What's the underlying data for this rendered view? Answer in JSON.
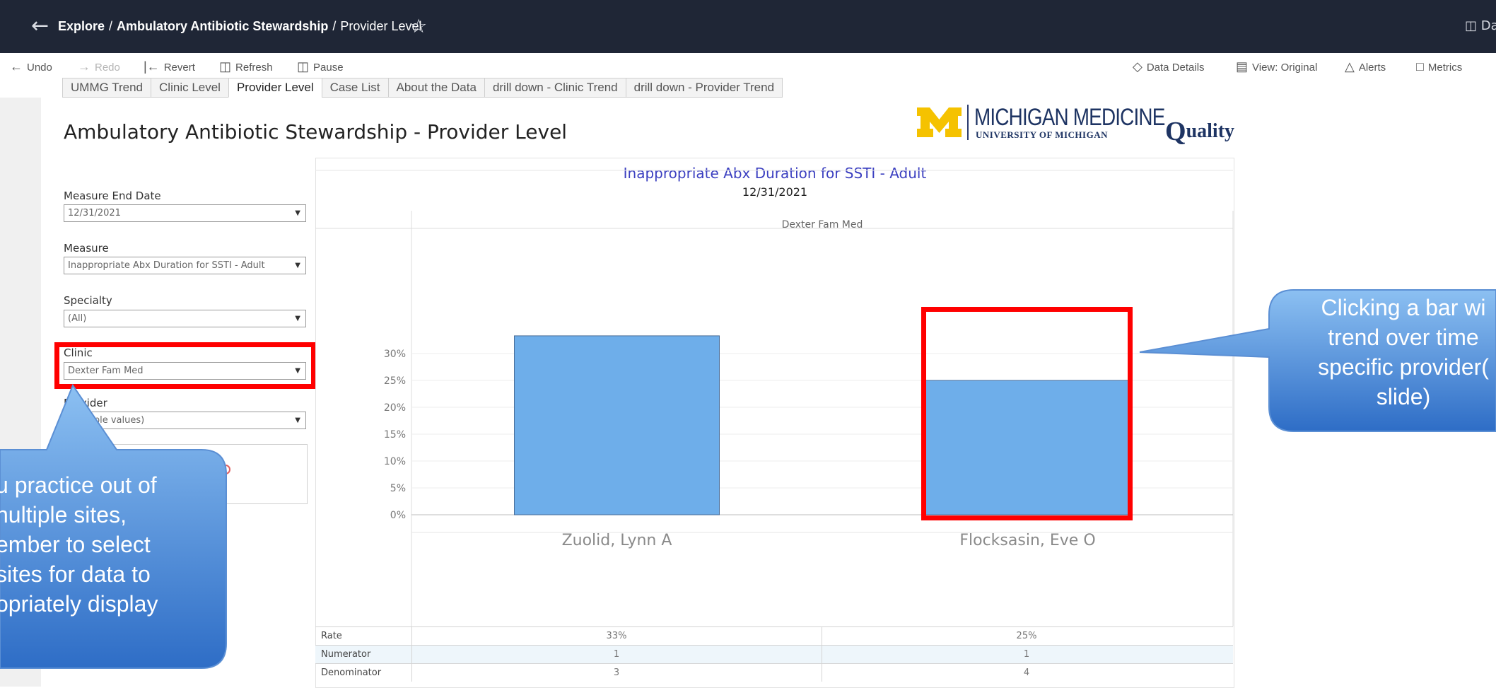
{
  "topbar": {
    "breadcrumb_explore": "Explore",
    "breadcrumb_sep1": "/",
    "breadcrumb_workbook": "Ambulatory Antibiotic Stewardship",
    "breadcrumb_sep2": "/",
    "breadcrumb_view": "Provider Level",
    "right_text": "Da"
  },
  "toolbar": {
    "undo": "Undo",
    "redo": "Redo",
    "revert": "Revert",
    "refresh": "Refresh",
    "pause": "Pause",
    "data_details": "Data Details",
    "view": "View: Original",
    "alerts": "Alerts",
    "metrics": "Metrics"
  },
  "tabs": [
    "UMMG Trend",
    "Clinic Level",
    "Provider Level",
    "Case List",
    "About the Data",
    "drill down - Clinic Trend",
    "drill down - Provider Trend"
  ],
  "active_tab": "Provider Level",
  "dashboard": {
    "title": "Ambulatory Antibiotic Stewardship - Provider Level"
  },
  "logo": {
    "main": "MICHIGAN MEDICINE",
    "sub": "UNIVERSITY OF MICHIGAN",
    "q_letter": "Q",
    "q_rest": "uality"
  },
  "filters": {
    "measure_end_date": {
      "label": "Measure End Date",
      "value": "12/31/2021"
    },
    "measure": {
      "label": "Measure",
      "value": "Inappropriate Abx Duration for SSTI - Adult"
    },
    "specialty": {
      "label": "Specialty",
      "value": "(All)"
    },
    "clinic": {
      "label": "Clinic",
      "value": "Dexter Fam Med"
    },
    "provider": {
      "label": "Provider",
      "value": "(Multiple values)"
    }
  },
  "chart_data": {
    "type": "bar",
    "title": "Inappropriate Abx Duration for SSTI - Adult",
    "subtitle": "12/31/2021",
    "panel_header": "Dexter Fam Med",
    "categories": [
      "Zuolid, Lynn A",
      "Flocksasin, Eve O"
    ],
    "values": [
      33.3,
      25
    ],
    "ylim": [
      0,
      35
    ],
    "yticks": [
      "0%",
      "5%",
      "10%",
      "15%",
      "20%",
      "25%",
      "30%"
    ],
    "bar_color": "#6eaeea",
    "grid": true
  },
  "table": {
    "rows": [
      {
        "label": "Rate",
        "values": [
          "33%",
          "25%"
        ]
      },
      {
        "label": "Numerator",
        "values": [
          "1",
          "1"
        ]
      },
      {
        "label": "Denominator",
        "values": [
          "3",
          "4"
        ]
      }
    ]
  },
  "callouts": {
    "left": [
      "u practice out of",
      "nultiple sites,",
      "ember to select",
      "sites for data to",
      "opriately display"
    ],
    "right": [
      "Clicking a bar wi",
      "trend over time",
      "specific provider(",
      "slide)"
    ]
  },
  "colors": {
    "topbar": "#1f2636",
    "highlight": "#ff0000",
    "callout_top": "#7fb7f0",
    "callout_bottom": "#2f6fc7"
  }
}
